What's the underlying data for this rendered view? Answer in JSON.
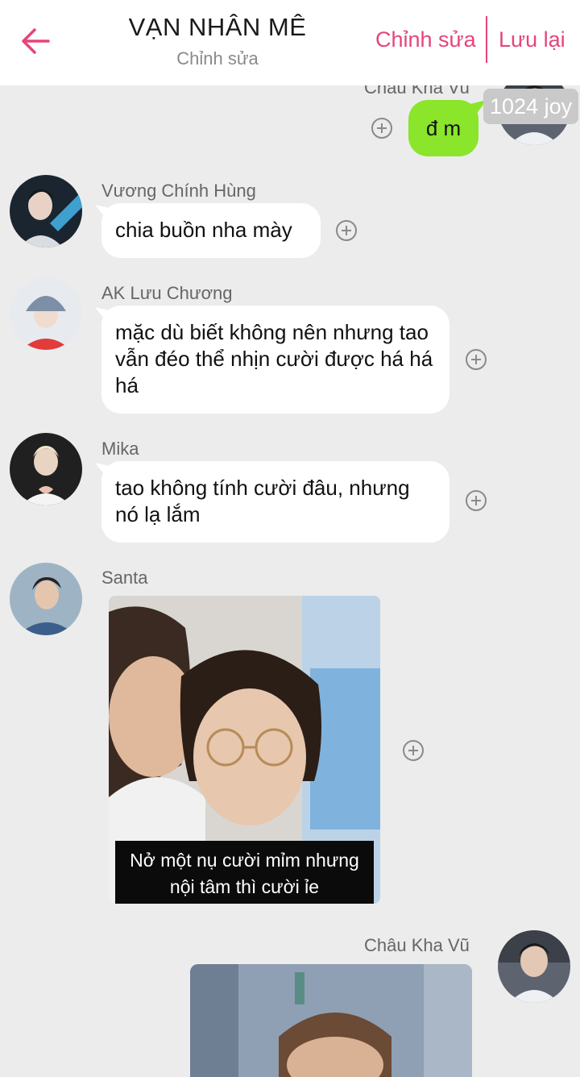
{
  "header": {
    "title": "VẠN NHÂN MÊ",
    "subtitle": "Chỉnh sửa",
    "edit_label": "Chỉnh sửa",
    "save_label": "Lưu lại",
    "accent_color": "#e5457a"
  },
  "messages": [
    {
      "sender": "Châu Kha Vũ",
      "side": "right",
      "text": "đ m",
      "badge": "1024 joy"
    },
    {
      "sender": "Vương Chính Hùng",
      "side": "left",
      "text": "chia buồn nha mày"
    },
    {
      "sender": "AK Lưu Chương",
      "side": "left",
      "text": "mặc dù biết không nên nhưng tao vẫn đéo thể nhịn cười được há há há"
    },
    {
      "sender": "Mika",
      "side": "left",
      "text": "tao không tính cười đâu, nhưng nó lạ lắm"
    },
    {
      "sender": "Santa",
      "side": "left",
      "type": "image",
      "caption_line1": "Nở một nụ cười mỉm nhưng",
      "caption_line2": "nội tâm thì cười ỉe"
    },
    {
      "sender": "Châu Kha Vũ",
      "side": "right",
      "type": "image"
    }
  ],
  "icons": {
    "back": "arrow-left-icon",
    "add": "plus-circle-icon"
  },
  "colors": {
    "own_bubble": "#8be52a",
    "background": "#ececec"
  }
}
